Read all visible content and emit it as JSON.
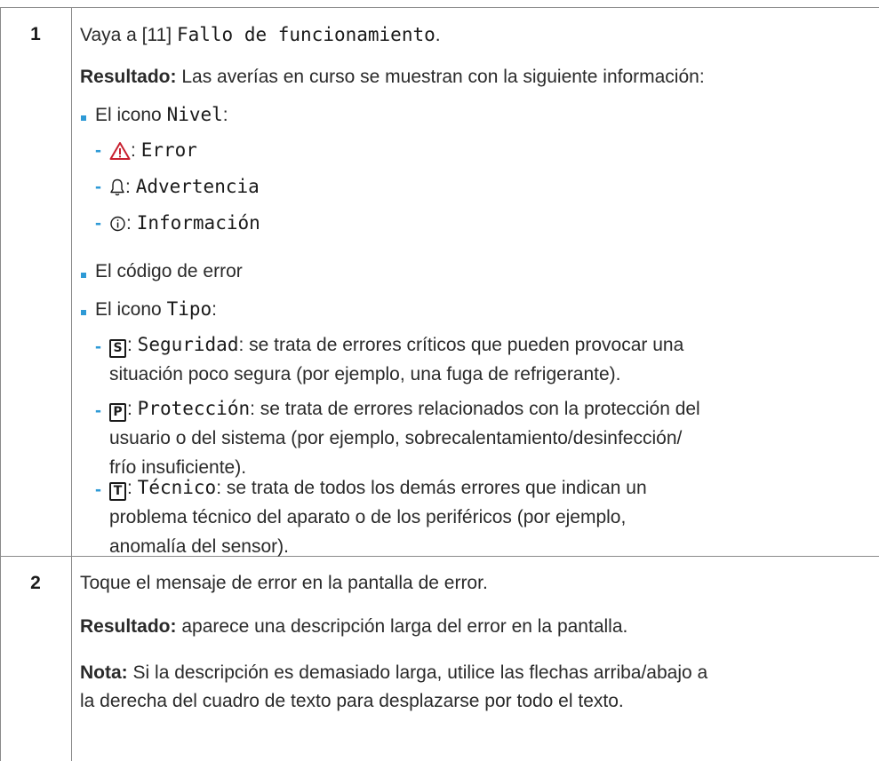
{
  "steps": [
    {
      "number": "1",
      "instruction_prefix": "Vaya a [11]",
      "instruction_menu": "Fallo de funcionamiento",
      "instruction_suffix": ".",
      "result_label": "Resultado:",
      "result_text": "Las averías en curso se muestran con la siguiente información:",
      "bullets": [
        {
          "prefix": "El icono",
          "term": "Nivel",
          "suffix": ":",
          "sub": [
            {
              "icon": "warning-triangle-icon",
              "sep": ":",
              "term": "Error"
            },
            {
              "icon": "bell-icon",
              "sep": ":",
              "term": "Advertencia"
            },
            {
              "icon": "info-circle-icon",
              "sep": ":",
              "term": "Información"
            }
          ]
        },
        {
          "text": "El código de error"
        },
        {
          "prefix": "El icono",
          "term": "Tipo",
          "suffix": ":",
          "sub": [
            {
              "icon_letter": "S",
              "term": "Seguridad",
              "lines": [
                "se trata de errores críticos que pueden provocar una",
                "situación poco segura (por ejemplo, una fuga de refrigerante)."
              ]
            },
            {
              "icon_letter": "P",
              "term": "Protección",
              "lines": [
                "se trata de errores relacionados con la protección del",
                "usuario o del sistema (por ejemplo, sobrecalentamiento/desinfección/",
                "frío insuficiente)."
              ]
            },
            {
              "icon_letter": "T",
              "term": "Técnico",
              "lines": [
                "se trata de todos los demás errores que indican un",
                "problema técnico del aparato o de los periféricos (por ejemplo,",
                "anomalía del sensor)."
              ]
            }
          ]
        }
      ]
    },
    {
      "number": "2",
      "instruction": "Toque el mensaje de error en la pantalla de error.",
      "result_label": "Resultado:",
      "result_text": "aparece una descripción larga del error en la pantalla.",
      "note_label": "Nota:",
      "note_lines": [
        "Si la descripción es demasiado larga, utilice las flechas arriba/abajo a",
        "la derecha del cuadro de texto para desplazarse por todo el texto."
      ]
    }
  ],
  "colors": {
    "warning_red": "#c8202f",
    "bullet_blue": "#2e9ad6",
    "rule_gray": "#8a8a8a"
  }
}
